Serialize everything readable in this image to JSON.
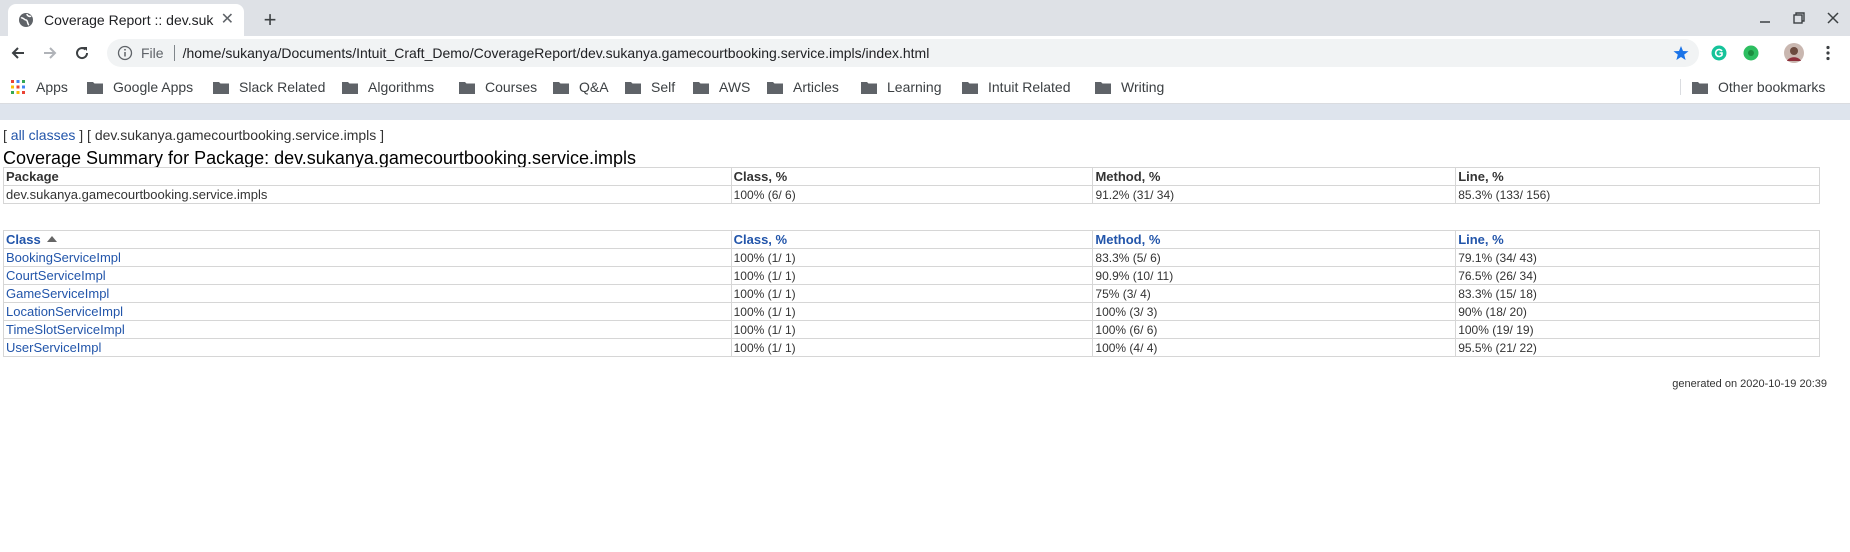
{
  "browser": {
    "tab_title": "Coverage Report :: dev.sukanya.gamecourtbooking.service.impls",
    "url_scheme": "File",
    "url": "/home/sukanya/Documents/Intuit_Craft_Demo/CoverageReport/dev.sukanya.gamecourtbooking.service.impls/index.html",
    "bookmarks": [
      {
        "label": "Apps",
        "icon": "apps-grid-icon"
      },
      {
        "label": "Google Apps",
        "icon": "folder-icon"
      },
      {
        "label": "Slack Related",
        "icon": "folder-icon"
      },
      {
        "label": "Algorithms",
        "icon": "folder-icon"
      },
      {
        "label": "Courses",
        "icon": "folder-icon"
      },
      {
        "label": "Q&A",
        "icon": "folder-icon"
      },
      {
        "label": "Self",
        "icon": "folder-icon"
      },
      {
        "label": "AWS",
        "icon": "folder-icon"
      },
      {
        "label": "Articles",
        "icon": "folder-icon"
      },
      {
        "label": "Learning",
        "icon": "folder-icon"
      },
      {
        "label": "Intuit Related",
        "icon": "folder-icon"
      },
      {
        "label": "Writing",
        "icon": "folder-icon"
      }
    ],
    "other_bookmarks": "Other bookmarks"
  },
  "report": {
    "breadcrumb": {
      "open": "[",
      "all_classes": "all classes",
      "mid": "] [",
      "current": "dev.sukanya.gamecourtbooking.service.impls",
      "close": "]"
    },
    "title": "Coverage Summary for Package: dev.sukanya.gamecourtbooking.service.impls",
    "package_table": {
      "headers": [
        "Package",
        "Class, %",
        "Method, %",
        "Line, %"
      ],
      "row": [
        "dev.sukanya.gamecourtbooking.service.impls",
        "100% (6/ 6)",
        "91.2% (31/ 34)",
        "85.3% (133/ 156)"
      ]
    },
    "class_table": {
      "headers": [
        "Class",
        "Class, %",
        "Method, %",
        "Line, %"
      ],
      "rows": [
        [
          "BookingServiceImpl",
          "100% (1/ 1)",
          "83.3% (5/ 6)",
          "79.1% (34/ 43)"
        ],
        [
          "CourtServiceImpl",
          "100% (1/ 1)",
          "90.9% (10/ 11)",
          "76.5% (26/ 34)"
        ],
        [
          "GameServiceImpl",
          "100% (1/ 1)",
          "75% (3/ 4)",
          "83.3% (15/ 18)"
        ],
        [
          "LocationServiceImpl",
          "100% (1/ 1)",
          "100% (3/ 3)",
          "90% (18/ 20)"
        ],
        [
          "TimeSlotServiceImpl",
          "100% (1/ 1)",
          "100% (6/ 6)",
          "100% (19/ 19)"
        ],
        [
          "UserServiceImpl",
          "100% (1/ 1)",
          "100% (4/ 4)",
          "95.5% (21/ 22)"
        ]
      ]
    },
    "footer": "generated on 2020-10-19 20:39"
  },
  "colors": {
    "link": "#2255aa",
    "page_strip": "#dee4ed",
    "tab_strip": "#dee1e6",
    "star": "#1a73e8"
  }
}
